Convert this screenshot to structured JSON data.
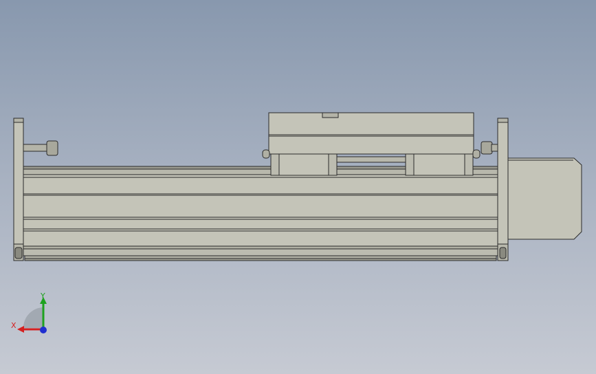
{
  "viewport": {
    "background_top": "#8898ae",
    "background_bottom": "#c6cad3"
  },
  "model": {
    "part_fill": "#c4c4b8",
    "part_edge": "#2a2a2a"
  },
  "triad": {
    "x_label": "X",
    "y_label": "Y",
    "x_color": "#d42020",
    "y_color": "#1ea21e",
    "z_color": "#1f2fd0"
  }
}
